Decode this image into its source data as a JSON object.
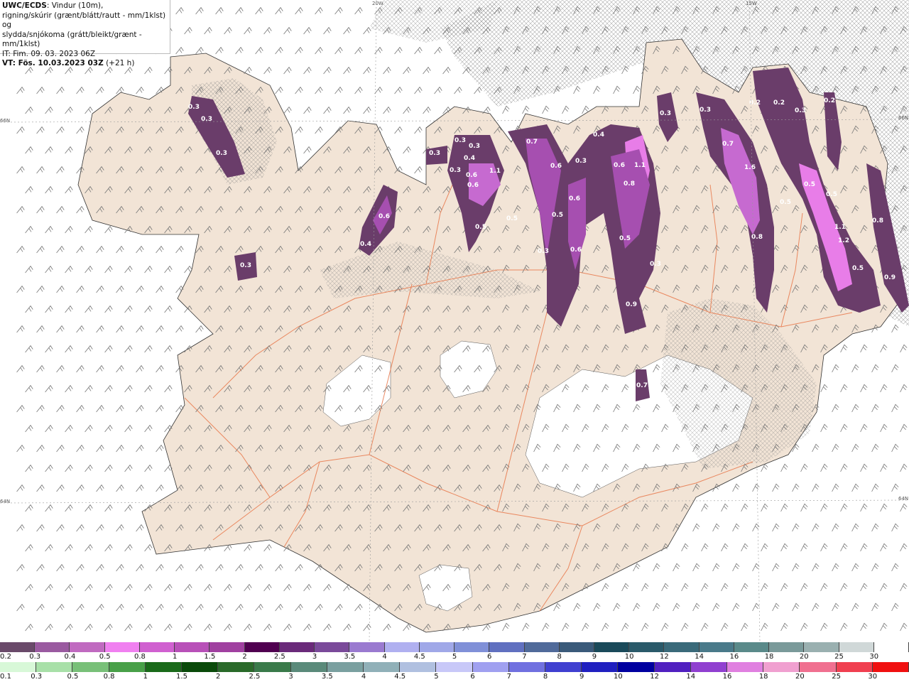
{
  "header": {
    "title_bold": "UWC/ECDS",
    "title_rest": ": Vindur (10m),",
    "line2": "rigning/skúrir (grænt/blátt/rautt - mm/1klst) og",
    "line3": "slydda/snjókoma (grátt/bleikt/grænt - mm/1klst)",
    "line4": "IT: Fim. 09. 03. 2023 06Z",
    "line5_bold": "VT: Fös. 10.03.2023 03Z",
    "line5_rest": " (+21 h)"
  },
  "grid_labels": {
    "lon20": "20W",
    "lon15": "15W",
    "lat66_left": "66N",
    "lat66_right": "66N",
    "lat64_left": "64N",
    "lat64_right": "64N"
  },
  "precip_labels": [
    "0.3",
    "0.3",
    "0.3",
    "0.3",
    "0.6",
    "0.4",
    "0.3",
    "0.3",
    "0.4",
    "0.3",
    "0.3",
    "0.6",
    "0.6",
    "1.1",
    "0.5",
    "0.5",
    "0.7",
    "0.6",
    "0.5",
    "0.3",
    "0.3",
    "0.6",
    "0.6",
    "0.4",
    "0.6",
    "1.1",
    "0.8",
    "0.5",
    "0.3",
    "0.9",
    "0.7",
    "0.3",
    "0.3",
    "0.7",
    "1.6",
    "0.2",
    "0.2",
    "0.2",
    "0.3",
    "0.8",
    "0.5",
    "0.5",
    "1.1",
    "1.2",
    "0.5",
    "0.9",
    "0.5",
    "0.8"
  ],
  "colors": {
    "land": "#f2e4d6",
    "sea": "#ffffff",
    "roads": "#e8774a",
    "snow_dark": "#6a3d6a",
    "snow_mid": "#a64fb0",
    "snow_light": "#e87de8"
  },
  "legend_top": {
    "labels": [
      "0.2",
      "0.3",
      "0.4",
      "0.5",
      "0.8",
      "1",
      "1.5",
      "2",
      "2.5",
      "3",
      "3.5",
      "4",
      "4.5",
      "5",
      "6",
      "7",
      "8",
      "9",
      "10",
      "12",
      "14",
      "16",
      "18",
      "20",
      "25",
      "30"
    ],
    "colors": [
      "#6a4a6a",
      "#9a5aa0",
      "#c06ac0",
      "#f080f0",
      "#d060d0",
      "#b850b8",
      "#a040a0",
      "#500050",
      "#6a2a7a",
      "#7a4a9a",
      "#9a7ad0",
      "#b0b0f0",
      "#a0a8e8",
      "#8090d8",
      "#6070c0",
      "#506a9a",
      "#3a5a7a",
      "#1a4a5a",
      "#2a5a6a",
      "#3a6a7a",
      "#4a7a8a",
      "#5a8a8a",
      "#7a9a9a",
      "#9ab0b0",
      "#d0d8d8",
      "#ffffff"
    ]
  },
  "legend_bottom": {
    "labels": [
      "0.1",
      "0.3",
      "0.5",
      "0.8",
      "1",
      "1.5",
      "2",
      "2.5",
      "3",
      "3.5",
      "4",
      "4.5",
      "5",
      "6",
      "7",
      "8",
      "9",
      "10",
      "12",
      "14",
      "16",
      "18",
      "20",
      "25",
      "30"
    ],
    "colors": [
      "#d8f8d8",
      "#a8e0a8",
      "#78c078",
      "#48a048",
      "#1a6a1a",
      "#0a4a0a",
      "#2a6a2a",
      "#3a7a4a",
      "#5a8a7a",
      "#7aa0a0",
      "#90b0b8",
      "#b0c0e0",
      "#c8c8f8",
      "#a0a0f0",
      "#7070e0",
      "#4040d0",
      "#2020c0",
      "#0000a0",
      "#5020c0",
      "#9040d0",
      "#e080e0",
      "#f0a0d0",
      "#f07090",
      "#f04050",
      "#f01010"
    ]
  }
}
